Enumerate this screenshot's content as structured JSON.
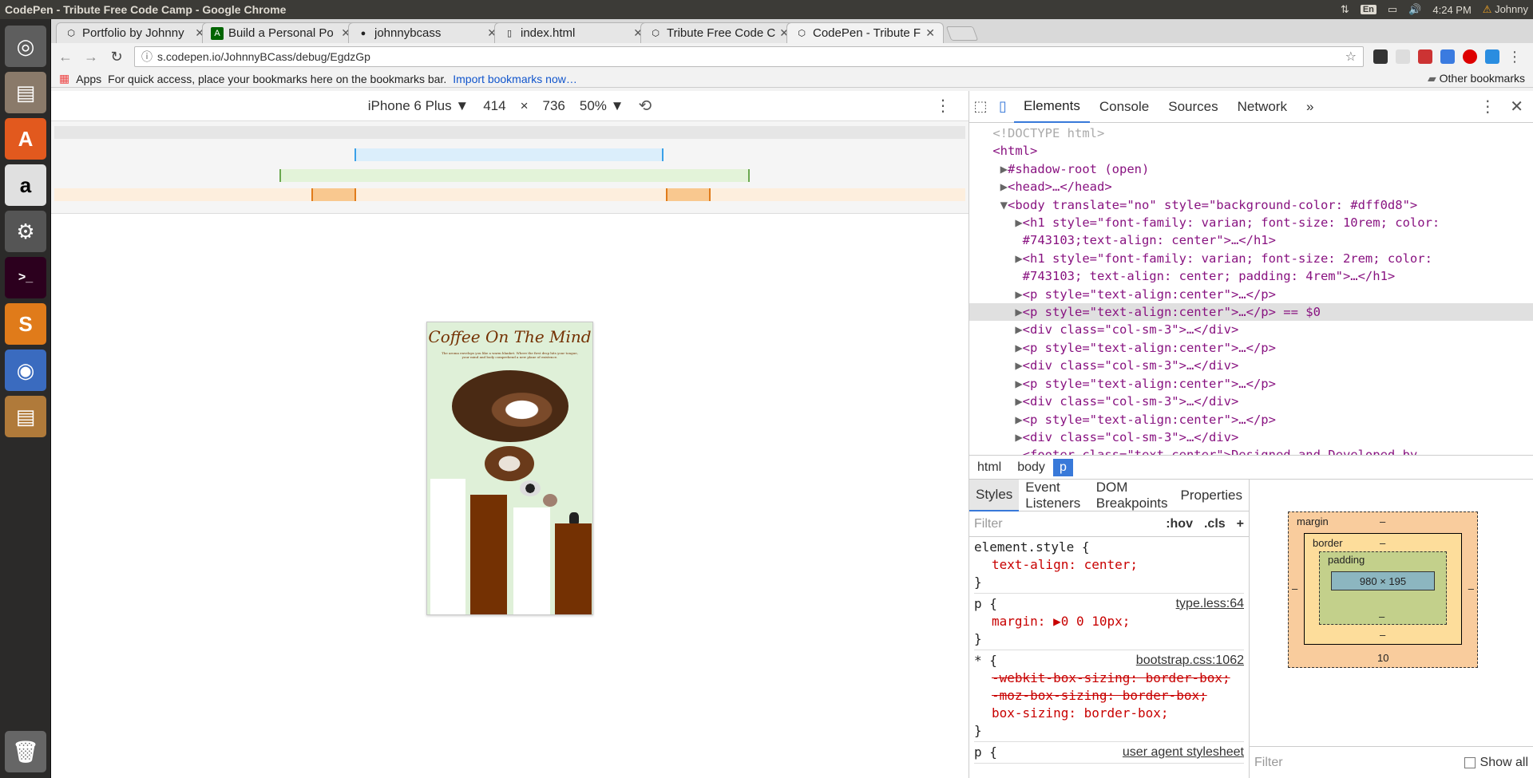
{
  "os_title": "CodePen - Tribute Free Code Camp - Google Chrome",
  "tray": {
    "keyboard": "En",
    "time": "4:24 PM",
    "user": "Johnny"
  },
  "launcher_icons": [
    "ubuntu-logo-icon",
    "files-icon",
    "software-center-icon",
    "amazon-icon",
    "settings-icon",
    "terminal-icon",
    "sublime-text-icon",
    "chrome-icon",
    "files-icon-2",
    "trash-icon"
  ],
  "tabs": [
    {
      "title": "Portfolio by Johnny",
      "favicon": "codepen-icon"
    },
    {
      "title": "Build a Personal Po",
      "favicon": "fcc-icon"
    },
    {
      "title": "johnnybcass",
      "favicon": "github-icon"
    },
    {
      "title": "index.html",
      "favicon": "file-icon"
    },
    {
      "title": "Tribute Free Code C",
      "favicon": "codepen-icon"
    },
    {
      "title": "CodePen - Tribute F",
      "favicon": "codepen-icon"
    }
  ],
  "url": "s.codepen.io/JohnnyBCass/debug/EgdzGp",
  "bookmarks": {
    "apps": "Apps",
    "prompt": "For quick access, place your bookmarks here on the bookmarks bar.",
    "import_link": "Import bookmarks now…",
    "other": "Other bookmarks"
  },
  "device_toolbar": {
    "device": "iPhone 6 Plus",
    "width": "414",
    "times": "×",
    "height": "736",
    "zoom": "50%"
  },
  "page_preview": {
    "heading": "Coffee On The Mind",
    "tagline": "The aroma envelops you like a warm blanket. Where the first drop hits your tongue, your mind and body comprehend a new plane of existence.",
    "bg_color": "#dff0d8",
    "heading_color": "#743103"
  },
  "devtools": {
    "tabs": [
      "Elements",
      "Console",
      "Sources",
      "Network"
    ],
    "more": "»",
    "dom_lines": [
      {
        "indent": 0,
        "arrow": "",
        "text": "<!DOCTYPE html>"
      },
      {
        "indent": 0,
        "arrow": "",
        "text": "<html>"
      },
      {
        "indent": 1,
        "arrow": "▶",
        "text": "#shadow-root (open)"
      },
      {
        "indent": 1,
        "arrow": "▶",
        "text": "<head>…</head>"
      },
      {
        "indent": 1,
        "arrow": "▼",
        "text": "<body translate=\"no\" style=\"background-color: #dff0d8\">"
      },
      {
        "indent": 2,
        "arrow": "▶",
        "text": "<h1 style=\"font-family: varian; font-size: 10rem; color:"
      },
      {
        "indent": 2,
        "arrow": "",
        "text": "#743103;text-align: center\">…</h1>"
      },
      {
        "indent": 2,
        "arrow": "▶",
        "text": "<h1 style=\"font-family: varian; font-size: 2rem; color:"
      },
      {
        "indent": 2,
        "arrow": "",
        "text": "#743103; text-align: center; padding: 4rem\">…</h1>"
      },
      {
        "indent": 2,
        "arrow": "▶",
        "text": "<p style=\"text-align:center\">…</p>"
      },
      {
        "indent": 2,
        "arrow": "▶",
        "text": "<p style=\"text-align:center\">…</p> == $0"
      },
      {
        "indent": 2,
        "arrow": "▶",
        "text": "<div class=\"col-sm-3\">…</div>"
      },
      {
        "indent": 2,
        "arrow": "▶",
        "text": "<p style=\"text-align:center\">…</p>"
      },
      {
        "indent": 2,
        "arrow": "▶",
        "text": "<div class=\"col-sm-3\">…</div>"
      },
      {
        "indent": 2,
        "arrow": "▶",
        "text": "<p style=\"text-align:center\">…</p>"
      },
      {
        "indent": 2,
        "arrow": "▶",
        "text": "<div class=\"col-sm-3\">…</div>"
      },
      {
        "indent": 2,
        "arrow": "▶",
        "text": "<p style=\"text-align:center\">…</p>"
      },
      {
        "indent": 2,
        "arrow": "▶",
        "text": "<div class=\"col-sm-3\">…</div>"
      },
      {
        "indent": 2,
        "arrow": "",
        "text": "<footer class=\"text-center\">Designed and Developed by"
      }
    ],
    "selected_line": 10,
    "breadcrumbs": [
      "html",
      "body",
      "p"
    ],
    "style_tabs": [
      "Styles",
      "Event Listeners",
      "DOM Breakpoints",
      "Properties"
    ],
    "filter_placeholder": "Filter",
    "hov": ":hov",
    "cls": ".cls",
    "plus": "+",
    "rules": [
      {
        "selector": "element.style {",
        "source": "",
        "props": [
          {
            "name": "text-align",
            "value": "center;",
            "strike": false
          }
        ]
      },
      {
        "selector": "p {",
        "source": "type.less:64",
        "props": [
          {
            "name": "margin",
            "value": "▶0 0 10px;",
            "strike": false
          }
        ]
      },
      {
        "selector": "* {",
        "source": "bootstrap.css:1062",
        "props": [
          {
            "name": "-webkit-box-sizing",
            "value": "border-box;",
            "strike": true
          },
          {
            "name": "-moz-box-sizing",
            "value": "border-box;",
            "strike": true
          },
          {
            "name": "box-sizing",
            "value": "border-box;",
            "strike": false
          }
        ]
      },
      {
        "selector": "p {",
        "source": "user agent stylesheet",
        "props": []
      }
    ],
    "box_model": {
      "margin_label": "margin",
      "border_label": "border",
      "padding_label": "padding",
      "content": "980 × 195",
      "dash": "–",
      "margin_bottom": "10"
    },
    "bm_filter": "Filter",
    "show_all": "Show all"
  }
}
